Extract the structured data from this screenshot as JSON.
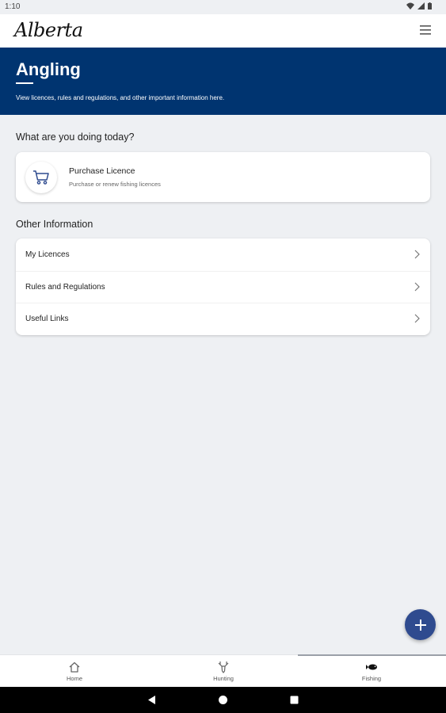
{
  "status_bar": {
    "time": "1:10"
  },
  "app_bar": {
    "logo_text": "Alberta",
    "menu_icon": "hamburger-menu-icon"
  },
  "hero": {
    "title": "Angling",
    "subtitle": "View licences, rules and regulations, and other important information here.",
    "background_color": "#003470"
  },
  "today_section": {
    "heading": "What are you doing today?",
    "purchase_card": {
      "icon": "shopping-cart-icon",
      "title": "Purchase Licence",
      "subtitle": "Purchase or renew fishing licences"
    }
  },
  "other_section": {
    "heading": "Other Information",
    "items": [
      {
        "label": "My Licences",
        "icon": "chevron-right-icon"
      },
      {
        "label": "Rules and Regulations",
        "icon": "chevron-right-icon"
      },
      {
        "label": "Useful Links",
        "icon": "chevron-right-icon"
      }
    ]
  },
  "fab": {
    "icon": "plus-icon",
    "color": "#2f4b8f"
  },
  "bottom_nav": {
    "items": [
      {
        "label": "Home",
        "icon": "home-icon"
      },
      {
        "label": "Hunting",
        "icon": "deer-head-icon"
      },
      {
        "label": "Fishing",
        "icon": "fish-icon"
      }
    ],
    "active": "Fishing"
  },
  "system_nav": {
    "back": "back-triangle-icon",
    "home": "home-circle-icon",
    "recents": "recents-square-icon"
  }
}
